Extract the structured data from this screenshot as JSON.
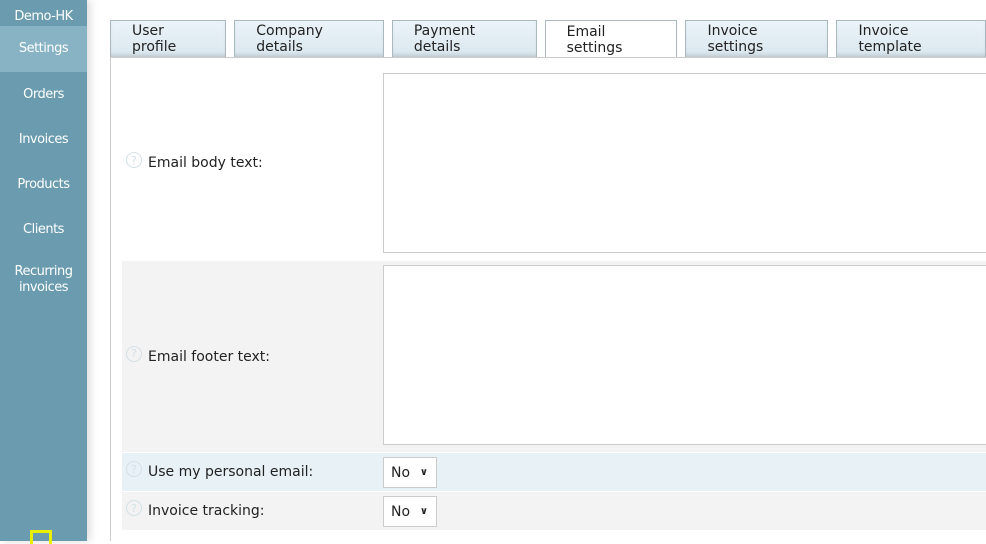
{
  "sidebar": {
    "company": "Demo-HK",
    "items": [
      {
        "label": "Settings",
        "active": true
      },
      {
        "label": "Orders"
      },
      {
        "label": "Invoices"
      },
      {
        "label": "Products"
      },
      {
        "label": "Clients"
      },
      {
        "label": "Recurring invoices"
      }
    ]
  },
  "tabs": [
    {
      "label": "User profile"
    },
    {
      "label": "Company details"
    },
    {
      "label": "Payment details"
    },
    {
      "label": "Email settings",
      "active": true
    },
    {
      "label": "Invoice settings"
    },
    {
      "label": "Invoice template"
    }
  ],
  "form": {
    "email_body": {
      "label": "Email body text:",
      "value": ""
    },
    "email_footer": {
      "label": "Email footer text:",
      "value": ""
    },
    "personal_email": {
      "label": "Use my personal email:",
      "value": "No"
    },
    "invoice_tracking": {
      "label": "Invoice tracking:",
      "value": "No"
    }
  },
  "colors": {
    "sidebar": "#6a9bae",
    "sidebar_active": "#87b3c5",
    "row_alt": "#f3f3f3",
    "row_highlight": "#e8f1f6"
  }
}
